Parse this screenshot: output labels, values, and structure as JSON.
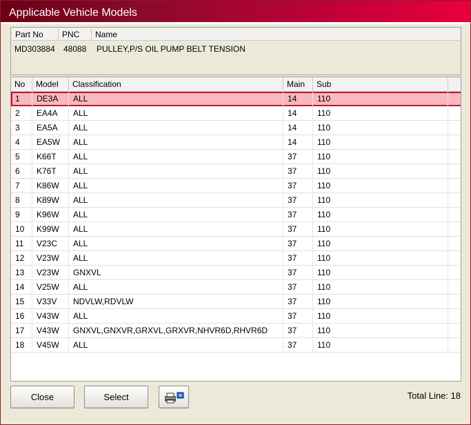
{
  "window": {
    "title": "Applicable Vehicle Models"
  },
  "part": {
    "headers": {
      "part_no": "Part No",
      "pnc": "PNC",
      "name": "Name"
    },
    "values": {
      "part_no": "MD303884",
      "pnc": "48088",
      "name": "PULLEY,P/S OIL PUMP BELT TENSION"
    }
  },
  "grid": {
    "headers": {
      "no": "No",
      "model": "Model",
      "classification": "Classification",
      "main": "Main",
      "sub": "Sub"
    },
    "selected_index": 0,
    "rows": [
      {
        "no": "1",
        "model": "DE3A",
        "classification": "ALL",
        "main": "14",
        "sub": "110"
      },
      {
        "no": "2",
        "model": "EA4A",
        "classification": "ALL",
        "main": "14",
        "sub": "110"
      },
      {
        "no": "3",
        "model": "EA5A",
        "classification": "ALL",
        "main": "14",
        "sub": "110"
      },
      {
        "no": "4",
        "model": "EA5W",
        "classification": "ALL",
        "main": "14",
        "sub": "110"
      },
      {
        "no": "5",
        "model": "K66T",
        "classification": "ALL",
        "main": "37",
        "sub": "110"
      },
      {
        "no": "6",
        "model": "K76T",
        "classification": "ALL",
        "main": "37",
        "sub": "110"
      },
      {
        "no": "7",
        "model": "K86W",
        "classification": "ALL",
        "main": "37",
        "sub": "110"
      },
      {
        "no": "8",
        "model": "K89W",
        "classification": "ALL",
        "main": "37",
        "sub": "110"
      },
      {
        "no": "9",
        "model": "K96W",
        "classification": "ALL",
        "main": "37",
        "sub": "110"
      },
      {
        "no": "10",
        "model": "K99W",
        "classification": "ALL",
        "main": "37",
        "sub": "110"
      },
      {
        "no": "11",
        "model": "V23C",
        "classification": "ALL",
        "main": "37",
        "sub": "110"
      },
      {
        "no": "12",
        "model": "V23W",
        "classification": "ALL",
        "main": "37",
        "sub": "110"
      },
      {
        "no": "13",
        "model": "V23W",
        "classification": "GNXVL",
        "main": "37",
        "sub": "110"
      },
      {
        "no": "14",
        "model": "V25W",
        "classification": "ALL",
        "main": "37",
        "sub": "110"
      },
      {
        "no": "15",
        "model": "V33V",
        "classification": "NDVLW,RDVLW",
        "main": "37",
        "sub": "110"
      },
      {
        "no": "16",
        "model": "V43W",
        "classification": "ALL",
        "main": "37",
        "sub": "110"
      },
      {
        "no": "17",
        "model": "V43W",
        "classification": "GNXVL,GNXVR,GRXVL,GRXVR,NHVR6D,RHVR6D",
        "main": "37",
        "sub": "110"
      },
      {
        "no": "18",
        "model": "V45W",
        "classification": "ALL",
        "main": "37",
        "sub": "110"
      }
    ]
  },
  "buttons": {
    "close": "Close",
    "select": "Select",
    "print_icon": "printer-icon"
  },
  "footer": {
    "total_line": "Total Line: 18"
  },
  "colors": {
    "title_gradient_start": "#6b0016",
    "title_gradient_end": "#e8003e",
    "selected_row_bg": "#f7b9bd",
    "selected_row_border": "#c8102e"
  }
}
